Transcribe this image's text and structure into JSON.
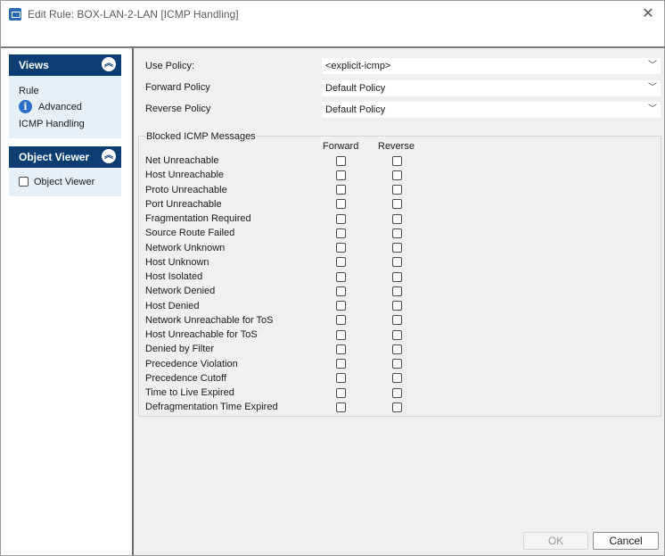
{
  "window": {
    "title": "Edit Rule: BOX-LAN-2-LAN [ICMP Handling]"
  },
  "sidebar": {
    "views": {
      "header": "Views",
      "items": [
        {
          "label": "Rule"
        },
        {
          "label": "Advanced"
        },
        {
          "label": "ICMP Handling"
        }
      ]
    },
    "object_viewer": {
      "header": "Object Viewer",
      "checkbox_label": "Object Viewer",
      "checked": false
    }
  },
  "main": {
    "use_policy": {
      "label": "Use Policy:",
      "value": "<explicit-icmp>"
    },
    "forward_policy": {
      "label": "Forward Policy",
      "value": "Default Policy"
    },
    "reverse_policy": {
      "label": "Reverse Policy",
      "value": "Default Policy"
    },
    "blocked": {
      "title": "Blocked ICMP Messages",
      "col_forward": "Forward",
      "col_reverse": "Reverse",
      "rows": [
        {
          "label": "Net Unreachable",
          "forward": false,
          "reverse": false
        },
        {
          "label": "Host Unreachable",
          "forward": false,
          "reverse": false
        },
        {
          "label": "Proto Unreachable",
          "forward": false,
          "reverse": false
        },
        {
          "label": "Port Unreachable",
          "forward": false,
          "reverse": false
        },
        {
          "label": "Fragmentation Required",
          "forward": false,
          "reverse": false
        },
        {
          "label": "Source Route Failed",
          "forward": false,
          "reverse": false
        },
        {
          "label": "Network Unknown",
          "forward": false,
          "reverse": false
        },
        {
          "label": "Host Unknown",
          "forward": false,
          "reverse": false
        },
        {
          "label": "Host Isolated",
          "forward": false,
          "reverse": false
        },
        {
          "label": "Network Denied",
          "forward": false,
          "reverse": false
        },
        {
          "label": "Host Denied",
          "forward": false,
          "reverse": false
        },
        {
          "label": "Network Unreachable for ToS",
          "forward": false,
          "reverse": false
        },
        {
          "label": "Host Unreachable for ToS",
          "forward": false,
          "reverse": false
        },
        {
          "label": "Denied by Filter",
          "forward": false,
          "reverse": false
        },
        {
          "label": "Precedence Violation",
          "forward": false,
          "reverse": false
        },
        {
          "label": "Precedence Cutoff",
          "forward": false,
          "reverse": false
        },
        {
          "label": "Time to Live Expired",
          "forward": false,
          "reverse": false
        },
        {
          "label": "Defragmentation Time Expired",
          "forward": false,
          "reverse": false
        }
      ]
    }
  },
  "buttons": {
    "ok": "OK",
    "cancel": "Cancel"
  }
}
